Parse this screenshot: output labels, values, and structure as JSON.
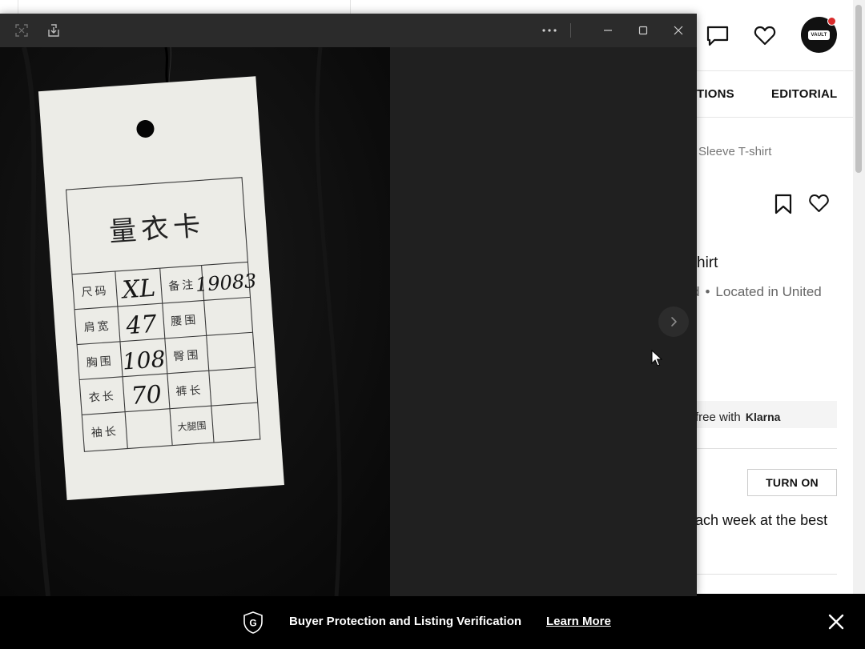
{
  "background_page": {
    "header": {
      "messages_icon": "chat-bubble-icon",
      "favorites_icon": "heart-icon",
      "avatar_badge": "VAULT"
    },
    "nav": {
      "partial_item": "TIONS",
      "editorial": "EDITORIAL"
    },
    "breadcrumb_tail": "Sleeve T-shirt",
    "product": {
      "title_fragment": "hirt",
      "meta_left": "d",
      "meta_separator": "•",
      "location": "Located in United"
    },
    "klarna": {
      "text": "free with",
      "brand": "Klarna"
    },
    "alerts": {
      "turn_on_label": "TURN ON",
      "description": "ach week at the best"
    }
  },
  "footer": {
    "shield_letter": "G",
    "protection_text": "Buyer Protection and Listing Verification",
    "learn_more": "Learn More"
  },
  "viewer": {
    "tag": {
      "title": "量衣卡",
      "rows": [
        {
          "label": "尺码",
          "value": "XL",
          "label2": "备注",
          "value2": "19083"
        },
        {
          "label": "肩宽",
          "value": "47",
          "label2": "腰围",
          "value2": ""
        },
        {
          "label": "胸围",
          "value": "108",
          "label2": "臀围",
          "value2": ""
        },
        {
          "label": "衣长",
          "value": "70",
          "label2": "裤长",
          "value2": ""
        },
        {
          "label": "袖长",
          "value": "",
          "label2": "大腿围",
          "value2": ""
        }
      ]
    }
  },
  "colors": {
    "viewer_bg": "#202020",
    "titlebar": "#2b2b2b",
    "footer_bg": "#000000",
    "notification": "#d92b2b",
    "buy_button": "#1f7a4d"
  }
}
